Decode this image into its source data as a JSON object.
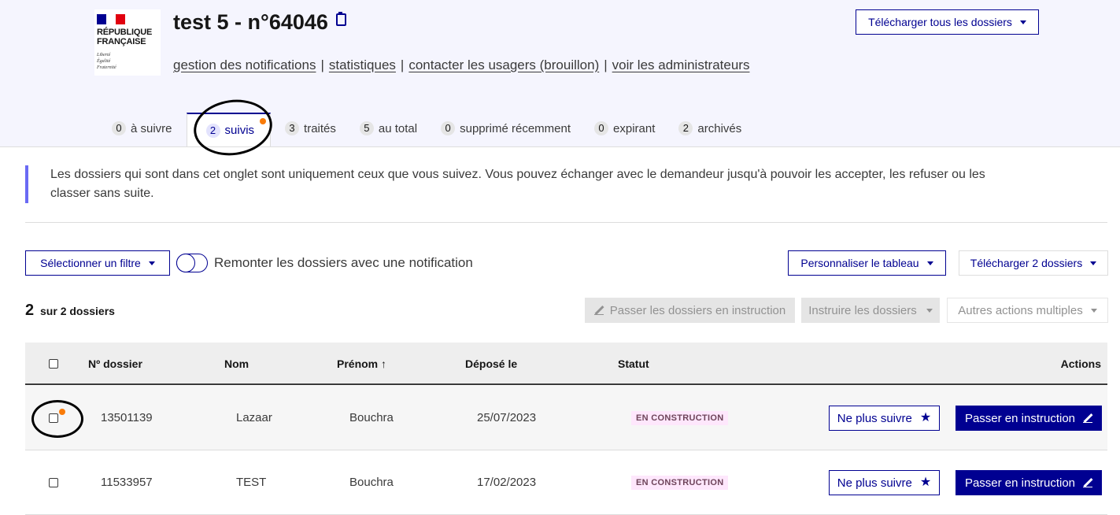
{
  "logo": {
    "lines": [
      "RÉPUBLIQUE",
      "FRANÇAISE"
    ],
    "motto": [
      "Liberté",
      "Égalité",
      "Fraternité"
    ],
    "flag_colors": [
      "#000091",
      "#ffffff",
      "#e1000f"
    ]
  },
  "header": {
    "title": "test 5 - n°64046",
    "download_all_label": "Télécharger tous les dossiers",
    "links": [
      "gestion des notifications",
      "statistiques",
      "contacter les usagers (brouillon)",
      "voir les administrateurs"
    ]
  },
  "tabs": [
    {
      "count": "0",
      "label": "à suivre"
    },
    {
      "count": "2",
      "label": "suivis"
    },
    {
      "count": "3",
      "label": "traités"
    },
    {
      "count": "5",
      "label": "au total"
    },
    {
      "count": "0",
      "label": "supprimé récemment"
    },
    {
      "count": "0",
      "label": "expirant"
    },
    {
      "count": "2",
      "label": "archivés"
    }
  ],
  "callout": {
    "text": "Les dossiers qui sont dans cet onglet sont uniquement ceux que vous suivez. Vous pouvez échanger avec le demandeur jusqu'à pouvoir les accepter, les refuser ou les classer sans suite."
  },
  "toolbar": {
    "filter_label": "Sélectionner un filtre",
    "toggle_label": "Remonter les dossiers avec une notification",
    "customize_label": "Personnaliser le tableau",
    "download_label": "Télécharger 2 dossiers"
  },
  "summary": {
    "count": "2",
    "suffix": "sur 2 dossiers"
  },
  "bulk": {
    "instruction_label": "Passer les dossiers en instruction",
    "instruire_label": "Instruire les dossiers",
    "other_label": "Autres actions multiples"
  },
  "table": {
    "headers": {
      "number": "Nº dossier",
      "nom": "Nom",
      "prenom": "Prénom ↑",
      "depose": "Déposé le",
      "statut": "Statut",
      "actions": "Actions"
    },
    "rows": [
      {
        "number": "13501139",
        "nom": "Lazaar",
        "prenom": "Bouchra",
        "depose": "25/07/2023",
        "statut": "EN CONSTRUCTION",
        "follow_label": "Ne plus suivre",
        "instruct_label": "Passer en instruction"
      },
      {
        "number": "11533957",
        "nom": "TEST",
        "prenom": "Bouchra",
        "depose": "17/02/2023",
        "statut": "EN CONSTRUCTION",
        "follow_label": "Ne plus suivre",
        "instruct_label": "Passer en instruction"
      }
    ]
  },
  "colors": {
    "primary": "#000091",
    "notification": "#f97b08",
    "badge_bg": "#fee7fc"
  }
}
